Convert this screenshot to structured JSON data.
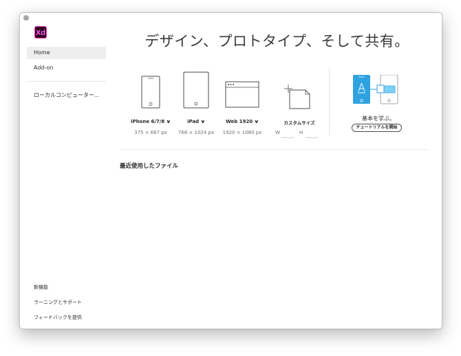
{
  "app": {
    "logo_text": "Xd"
  },
  "sidebar": {
    "items": [
      {
        "label": "Home",
        "active": true
      },
      {
        "label": "Add-on",
        "active": false
      },
      {
        "label": "ローカルコンピューター..."
      }
    ],
    "footer": [
      {
        "label": "新機能"
      },
      {
        "label": "ラーニングとサポート"
      },
      {
        "label": "フィードバックを提供"
      }
    ]
  },
  "main": {
    "headline": "デザイン、プロトタイプ、そして共有。",
    "presets": [
      {
        "name": "iPhone 6/7/8",
        "size": "375 × 667 px",
        "icon": "phone-icon"
      },
      {
        "name": "iPad",
        "size": "768 × 1024 px",
        "icon": "tablet-icon"
      },
      {
        "name": "Web 1920",
        "size": "1920 × 1080 px",
        "icon": "browser-window-icon"
      }
    ],
    "custom": {
      "name": "カスタムサイズ",
      "width_label": "W",
      "height_label": "H",
      "width_value": "",
      "height_value": ""
    },
    "learn": {
      "caption": "基本を学ぶ。",
      "button": "チュートリアルを開始"
    },
    "recent_title": "最近使用したファイル"
  },
  "colors": {
    "brand_border": "#ff2bc2",
    "brand_bg": "#2e001f",
    "learn_blue": "#2fa2e0",
    "learn_light_blue": "#7fd0f5"
  }
}
